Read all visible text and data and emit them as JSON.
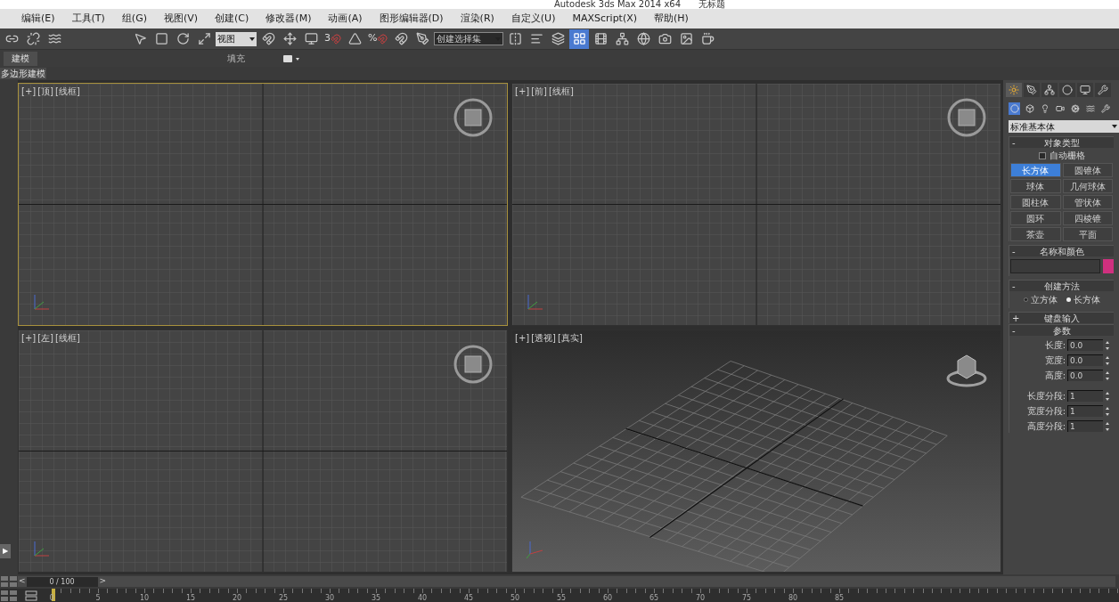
{
  "window": {
    "title": "Autodesk 3ds Max  2014 x64",
    "document": "无标题"
  },
  "menu": [
    "编辑(E)",
    "工具(T)",
    "组(G)",
    "视图(V)",
    "创建(C)",
    "修改器(M)",
    "动画(A)",
    "图形编辑器(D)",
    "渲染(R)",
    "自定义(U)",
    "MAXScript(X)",
    "帮助(H)"
  ],
  "toolbar": {
    "view_dropdown": "视图",
    "snap_label": "3",
    "percent_label": "%",
    "selection_set": "创建选择集"
  },
  "ribbon_tabs": [
    {
      "label": "建模",
      "selected": true
    },
    {
      "label": "填充",
      "selected": false
    }
  ],
  "ribbon_panel": "多边形建模",
  "viewports": [
    {
      "kind": "ortho",
      "plus": "[+]",
      "view": "[顶]",
      "shading": "[线框]",
      "selected": true
    },
    {
      "kind": "ortho",
      "plus": "[+]",
      "view": "[前]",
      "shading": "[线框]",
      "selected": false
    },
    {
      "kind": "ortho",
      "plus": "[+]",
      "view": "[左]",
      "shading": "[线框]",
      "selected": false
    },
    {
      "kind": "perspective",
      "plus": "[+]",
      "view": "[透视]",
      "shading": "[真实]",
      "selected": false
    }
  ],
  "command_panel": {
    "category": "标准基本体",
    "object_type": {
      "title": "对象类型",
      "collapse": "-",
      "autogrid": {
        "label": "自动栅格",
        "checked": false
      },
      "buttons": [
        {
          "label": "长方体",
          "selected": true
        },
        {
          "label": "圆锥体",
          "selected": false
        },
        {
          "label": "球体",
          "selected": false
        },
        {
          "label": "几何球体",
          "selected": false
        },
        {
          "label": "圆柱体",
          "selected": false
        },
        {
          "label": "管状体",
          "selected": false
        },
        {
          "label": "圆环",
          "selected": false
        },
        {
          "label": "四棱锥",
          "selected": false
        },
        {
          "label": "茶壶",
          "selected": false
        },
        {
          "label": "平面",
          "selected": false
        }
      ]
    },
    "name_color": {
      "title": "名称和颜色",
      "collapse": "-",
      "color": "#d0307f"
    },
    "creation_method": {
      "title": "创建方法",
      "collapse": "-",
      "options": [
        {
          "label": "立方体",
          "selected": false
        },
        {
          "label": "长方体",
          "selected": true
        }
      ]
    },
    "keyboard_entry": {
      "title": "键盘输入",
      "collapse": "+"
    },
    "parameters": {
      "title": "参数",
      "collapse": "-",
      "fields": [
        {
          "label": "长度:",
          "value": "0.0"
        },
        {
          "label": "宽度:",
          "value": "0.0"
        },
        {
          "label": "高度:",
          "value": "0.0"
        },
        {
          "label": "长度分段:",
          "value": "1"
        },
        {
          "label": "宽度分段:",
          "value": "1"
        },
        {
          "label": "高度分段:",
          "value": "1"
        }
      ]
    }
  },
  "side_button": "▶",
  "timeline": {
    "prev": "<",
    "frame": "0 / 100",
    "next": ">",
    "ticks": [
      "0",
      "5",
      "10",
      "15",
      "20",
      "25",
      "30",
      "35",
      "40",
      "45",
      "50",
      "55",
      "60",
      "65",
      "70",
      "75",
      "80",
      "85"
    ]
  }
}
